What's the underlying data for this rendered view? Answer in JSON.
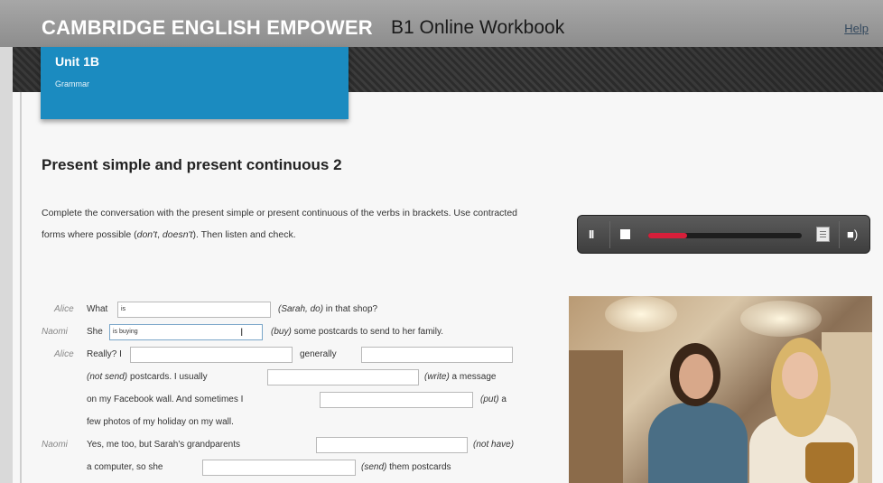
{
  "header": {
    "brand": "CAMBRIDGE ENGLISH EMPOWER",
    "subtitle": "B1 Online Workbook",
    "help": "Help"
  },
  "unit": {
    "title": "Unit 1B",
    "subtitle": "Grammar"
  },
  "exercise": {
    "title": "Present simple and present continuous 2",
    "instructions": {
      "part1": "Complete the conversation with the present simple or present continuous of the verbs in brackets. Use contracted forms where possible (",
      "ex1": "don't",
      "sep": ", ",
      "ex2": "doesn't",
      "part2": "). Then listen and check."
    }
  },
  "audio": {
    "pause_symbol": "II",
    "progress": 0.25,
    "icons": [
      "pause-icon",
      "stop-icon",
      "transcript-icon",
      "volume-icon"
    ]
  },
  "dialog": {
    "l1": {
      "speaker": "Alice",
      "a": "What",
      "f1": "is",
      "b": "(Sarah, do)",
      "c": " in that shop?"
    },
    "l2": {
      "speaker": "Naomi",
      "a": "She",
      "f1": "is buying",
      "b": "(buy)",
      "c": " some postcards to send to her family."
    },
    "l3": {
      "speaker": "Alice",
      "a": "Really? I",
      "f1": "",
      "b": "generally",
      "f2": ""
    },
    "l4": {
      "a": "(not send)",
      "b": " postcards. I usually",
      "f1": "",
      "c": "(write)",
      "d": " a message"
    },
    "l5": {
      "a": "on my Facebook wall. And sometimes I",
      "f1": "",
      "b": "(put)",
      "c": " a"
    },
    "l6": {
      "a": "few photos of my holiday on my wall."
    },
    "l7": {
      "speaker": "Naomi",
      "a": "Yes, me too, but Sarah's grandparents",
      "f1": "",
      "b": "(not have)"
    },
    "l8": {
      "a": "a computer, so she",
      "f1": "",
      "b": "(send)",
      "c": " them postcards"
    }
  },
  "colors": {
    "header": "#9a9a9a",
    "unit_tab": "#1b8bc0",
    "progress": "#d61f3a"
  }
}
